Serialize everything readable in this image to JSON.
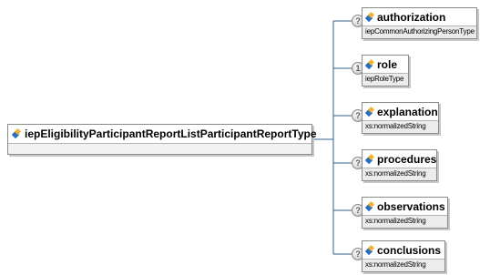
{
  "root": {
    "name": "iepEligibilityParticipantReportListParticipantReportType"
  },
  "children": [
    {
      "name": "authorization",
      "type": "iepCommonAuthorizingPersonType",
      "badge": "?"
    },
    {
      "name": "role",
      "type": "iepRoleType",
      "badge": "1"
    },
    {
      "name": "explanation",
      "type": "xs:normalizedString",
      "badge": "?"
    },
    {
      "name": "procedures",
      "type": "xs:normalizedString",
      "badge": "?"
    },
    {
      "name": "observations",
      "type": "xs:normalizedString",
      "badge": "?"
    },
    {
      "name": "conclusions",
      "type": "xs:normalizedString",
      "badge": "?"
    }
  ]
}
